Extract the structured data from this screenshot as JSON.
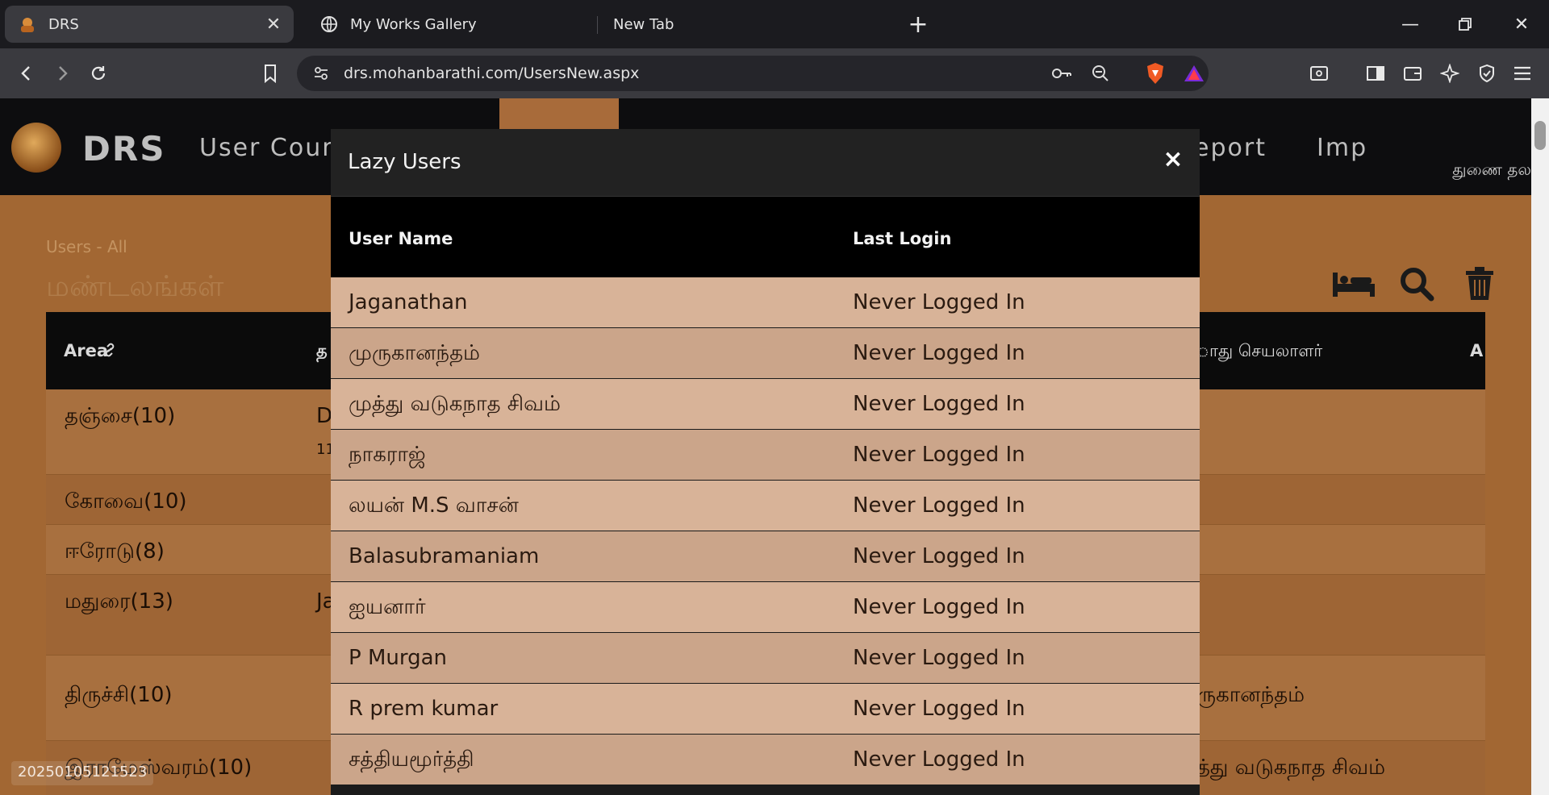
{
  "browser": {
    "tabs": [
      {
        "title": "DRS",
        "active": true
      },
      {
        "title": "My Works Gallery",
        "active": false
      },
      {
        "title": "New Tab",
        "active": false
      }
    ],
    "url": "drs.mohanbarathi.com/UsersNew.aspx"
  },
  "site": {
    "brand": "DRS",
    "nav": [
      "User Count",
      "eport",
      "Imp"
    ],
    "nav_right": "துணை தல",
    "breadcrumb": "Users - All",
    "page_title": "மண்டலங்கள்",
    "table_headers": {
      "area": "Area",
      "second": "த",
      "third": "ாது செயலாளர்",
      "fourth": "A"
    },
    "rows": [
      {
        "area": "தஞ்சை(10)",
        "b": "D",
        "sub": "11",
        "c": ""
      },
      {
        "area": "கோவை(10)",
        "b": "",
        "sub": "",
        "c": ""
      },
      {
        "area": "ஈரோடு(8)",
        "b": "",
        "sub": "",
        "c": ""
      },
      {
        "area": "மதுரை(13)",
        "b": "Ja",
        "sub": "",
        "c": ""
      },
      {
        "area": "திருச்சி(10)",
        "b": "",
        "sub": "",
        "c": "ருகானந்தம்"
      },
      {
        "area": "இராமேஸ்வரம்(10)",
        "b": "",
        "sub": "",
        "c": "த்து வடுகநாத சிவம்"
      }
    ],
    "stamp": "20250105121523"
  },
  "modal": {
    "title": "Lazy Users",
    "close_label": "×",
    "columns": {
      "user": "User Name",
      "last": "Last Login"
    },
    "users": [
      {
        "name": "Jaganathan",
        "last": "Never Logged In"
      },
      {
        "name": "முருகானந்தம்",
        "last": "Never Logged In"
      },
      {
        "name": "முத்து வடுகநாத சிவம்",
        "last": "Never Logged In"
      },
      {
        "name": "நாகராஜ்",
        "last": "Never Logged In"
      },
      {
        "name": "லயன் M.S வாசன்",
        "last": "Never Logged In"
      },
      {
        "name": "Balasubramaniam",
        "last": "Never Logged In"
      },
      {
        "name": "ஐயனார்",
        "last": "Never Logged In"
      },
      {
        "name": "P Murgan",
        "last": "Never Logged In"
      },
      {
        "name": "R prem kumar",
        "last": "Never Logged In"
      },
      {
        "name": "சத்தியமூர்த்தி",
        "last": "Never Logged In"
      }
    ]
  }
}
